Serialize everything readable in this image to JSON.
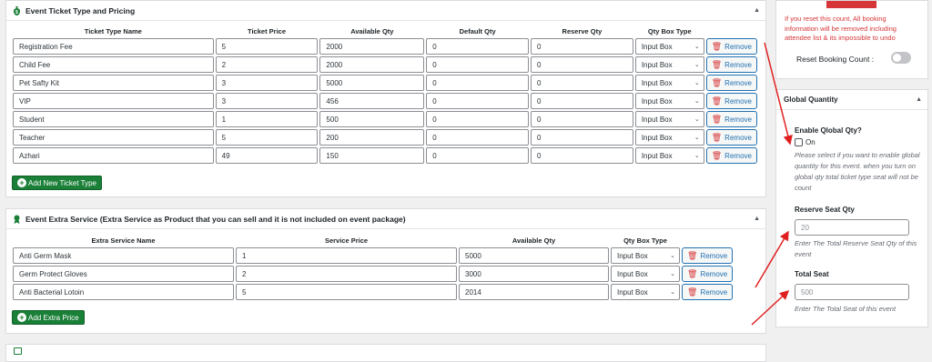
{
  "ticket_panel": {
    "title": "Event Ticket Type and Pricing",
    "headers": [
      "Ticket Type Name",
      "Ticket Price",
      "Available Qty",
      "Default Qty",
      "Reserve Qty",
      "Qty Box Type"
    ],
    "rows": [
      {
        "name": "Registration Fee",
        "price": "5",
        "available": "2000",
        "default": "0",
        "reserve": "0",
        "box": "Input Box"
      },
      {
        "name": "Child Fee",
        "price": "2",
        "available": "2000",
        "default": "0",
        "reserve": "0",
        "box": "Input Box"
      },
      {
        "name": "Pet Safty Kit",
        "price": "3",
        "available": "5000",
        "default": "0",
        "reserve": "0",
        "box": "Input Box"
      },
      {
        "name": "VIP",
        "price": "3",
        "available": "456",
        "default": "0",
        "reserve": "0",
        "box": "Input Box"
      },
      {
        "name": "Student",
        "price": "1",
        "available": "500",
        "default": "0",
        "reserve": "0",
        "box": "Input Box"
      },
      {
        "name": "Teacher",
        "price": "5",
        "available": "200",
        "default": "0",
        "reserve": "0",
        "box": "Input Box"
      },
      {
        "name": "Azhari",
        "price": "49",
        "available": "150",
        "default": "0",
        "reserve": "0",
        "box": "Input Box"
      }
    ],
    "remove_label": "Remove",
    "add_label": "Add New Ticket Type"
  },
  "extra_panel": {
    "title": "Event Extra Service (Extra Service as Product that you can sell and it is not included on event package)",
    "headers": [
      "Extra Service Name",
      "Service Price",
      "Available Qty",
      "Qty Box Type"
    ],
    "rows": [
      {
        "name": "Anti Germ Mask",
        "price": "1",
        "available": "5000",
        "box": "Input Box"
      },
      {
        "name": "Germ Protect Gloves",
        "price": "2",
        "available": "3000",
        "box": "Input Box"
      },
      {
        "name": "Anti Bacterial Lotoin",
        "price": "5",
        "available": "2014",
        "box": "Input Box"
      }
    ],
    "remove_label": "Remove",
    "add_label": "Add Extra Price"
  },
  "reset_panel": {
    "warning": "If you reset this count, All booking information will be removed including attendee list & its impossible to undo",
    "toggle_label": "Reset Booking Count :"
  },
  "global_panel": {
    "title": "Global Quantity",
    "enable_label": "Enable Qlobal Qty?",
    "on_label": "On",
    "enable_help": "Please select if you want to enable global quantity for this event. when you turn on global qty total ticket type seat will not be count",
    "reserve_label": "Reserve Seat Qty",
    "reserve_value": "20",
    "reserve_help": "Enter The Total Reserve Seat Qty of this event",
    "total_label": "Total Seat",
    "total_value": "500",
    "total_help": "Enter The Total Seat of this event"
  },
  "colors": {
    "accent": "#2271b1",
    "danger": "#d63638",
    "green": "#1a7f37",
    "arrow": "#e02020"
  }
}
